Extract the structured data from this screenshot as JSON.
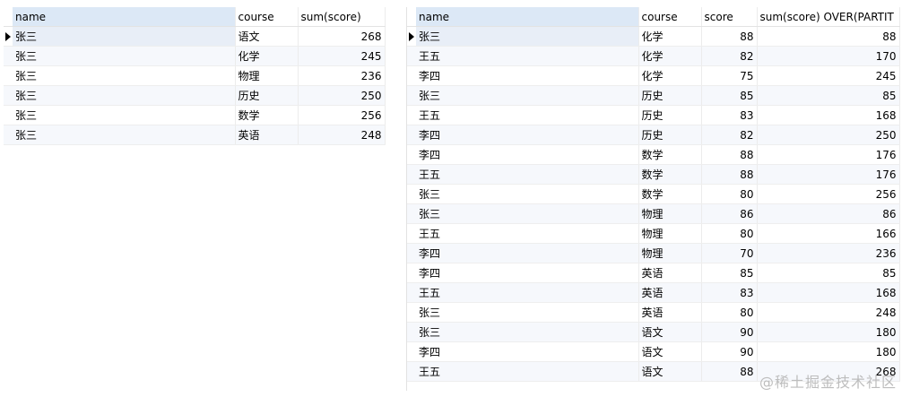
{
  "left_grid": {
    "columns": [
      "name",
      "course",
      "sum(score)"
    ],
    "rows": [
      [
        "张三",
        "语文",
        "268"
      ],
      [
        "张三",
        "化学",
        "245"
      ],
      [
        "张三",
        "物理",
        "236"
      ],
      [
        "张三",
        "历史",
        "250"
      ],
      [
        "张三",
        "数学",
        "256"
      ],
      [
        "张三",
        "英语",
        "248"
      ]
    ]
  },
  "right_grid": {
    "columns": [
      "name",
      "course",
      "score",
      "sum(score) OVER(PARTIT"
    ],
    "rows": [
      [
        "张三",
        "化学",
        "88",
        "88"
      ],
      [
        "王五",
        "化学",
        "82",
        "170"
      ],
      [
        "李四",
        "化学",
        "75",
        "245"
      ],
      [
        "张三",
        "历史",
        "85",
        "85"
      ],
      [
        "王五",
        "历史",
        "83",
        "168"
      ],
      [
        "李四",
        "历史",
        "82",
        "250"
      ],
      [
        "李四",
        "数学",
        "88",
        "176"
      ],
      [
        "王五",
        "数学",
        "88",
        "176"
      ],
      [
        "张三",
        "数学",
        "80",
        "256"
      ],
      [
        "张三",
        "物理",
        "86",
        "86"
      ],
      [
        "王五",
        "物理",
        "80",
        "166"
      ],
      [
        "李四",
        "物理",
        "70",
        "236"
      ],
      [
        "李四",
        "英语",
        "85",
        "85"
      ],
      [
        "王五",
        "英语",
        "83",
        "168"
      ],
      [
        "张三",
        "英语",
        "80",
        "248"
      ],
      [
        "张三",
        "语文",
        "90",
        "180"
      ],
      [
        "李四",
        "语文",
        "90",
        "180"
      ],
      [
        "王五",
        "语文",
        "88",
        "268"
      ]
    ]
  },
  "watermark": "@稀土掘金技术社区"
}
